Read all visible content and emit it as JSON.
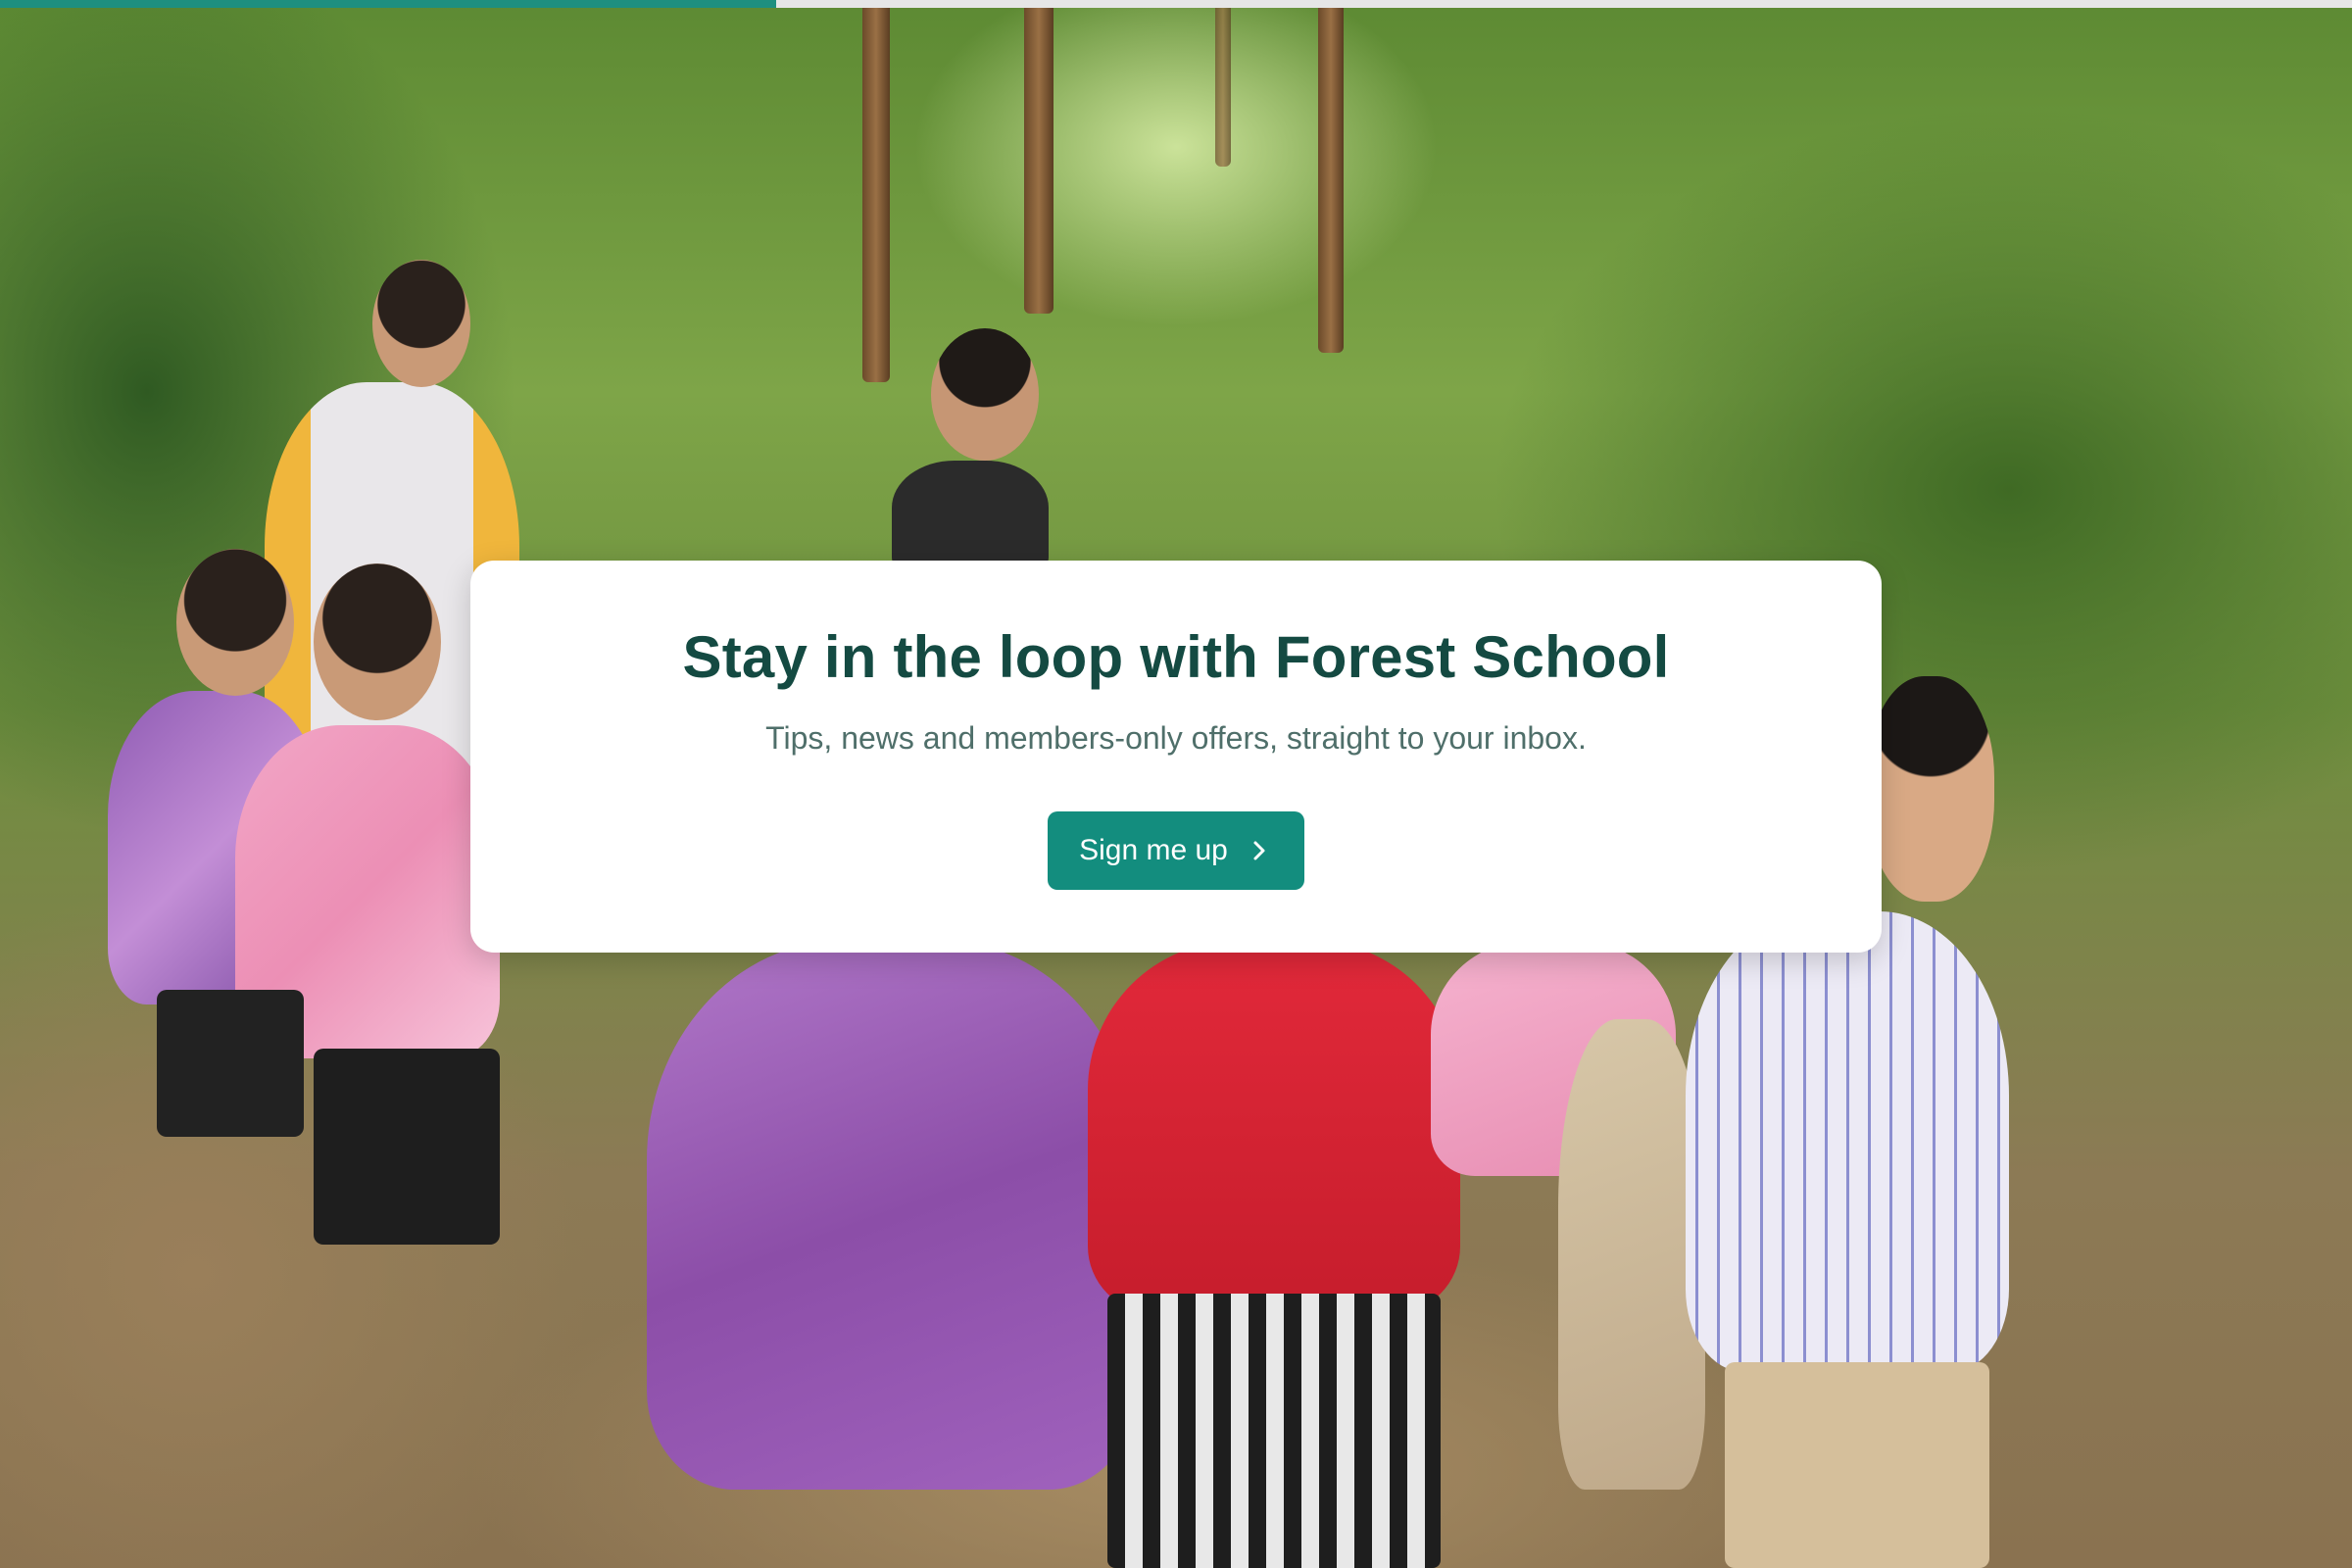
{
  "progress": {
    "value": 0.33,
    "color": "#1e8f7f"
  },
  "background": {
    "icon": "forest-children-photo"
  },
  "signup_card": {
    "title": "Stay in the loop with Forest School",
    "subtitle": "Tips, news and members-only offers, straight to your inbox.",
    "button_label": "Sign me up",
    "button_icon": "chevron-right-icon",
    "accent_color": "#138d7e",
    "title_color": "#144a42"
  }
}
